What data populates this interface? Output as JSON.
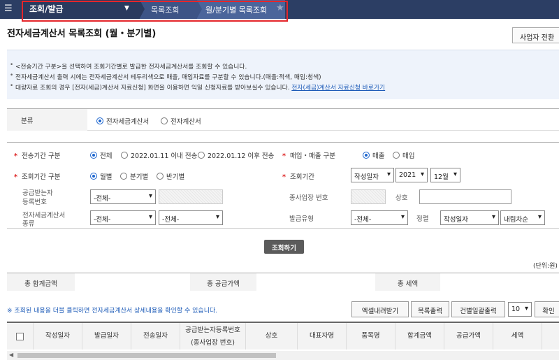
{
  "topbar": {
    "menu_icon": "hamburger-icon",
    "section_title": "조회/발급",
    "breadcrumb": [
      "목록조회",
      "월/분기별 목록조회"
    ],
    "favorite_icon": "star-icon"
  },
  "page": {
    "title": "전자세금계산서 목록조회 (월・분기별)",
    "biz_switch_label": "사업자 전환"
  },
  "notice": {
    "lines": [
      "<전송기간 구분>을 선택하여 조회기간별로 발급한 전자세금계산서를 조회할 수 있습니다.",
      "전자세금계산서 출력 시에는 전자세금계산서 테두리색으로 매출, 매입자료를 구분할 수 있습니다.(매출:적색, 매입:청색)",
      "대량자료 조회의 경우 [전자(세금)계산서 자료신청] 화면을 이용하면 익일 신청자료를 받아보실수 있습니다."
    ],
    "link_text": "전자(세금)계산서 자료신청 바로가기"
  },
  "classification": {
    "label": "분류",
    "options": [
      "전자세금계산서",
      "전자계산서"
    ],
    "selected": "전자세금계산서"
  },
  "search": {
    "transmit_period_label": "전송기간 구분",
    "transmit_options": [
      "전체",
      "2022.01.11 이내 전송",
      "2022.01.12 이후 전송"
    ],
    "sales_purchase_label": "매입・매출 구분",
    "sales_purchase_options": [
      "매출",
      "매입"
    ],
    "period_type_label": "조회기간 구분",
    "period_type_options": [
      "월별",
      "분기별",
      "반기별"
    ],
    "period_label": "조회기간",
    "period_basis": "작성일자",
    "year": "2021",
    "month": "12월",
    "receiver_reg_label_1": "공급받는자",
    "receiver_reg_label_2": "등록번호",
    "receiver_reg_select": "-전체-",
    "subbiz_label": "종사업장 번호",
    "company_label": "상호",
    "invoice_type_label_1": "전자세금계산서",
    "invoice_type_label_2": "종류",
    "invoice_type_select_1": "-전체-",
    "invoice_type_select_2": "-전체-",
    "issue_type_label": "발급유형",
    "issue_type_select": "-전체-",
    "sort_label": "정렬",
    "sort_by": "작성일자",
    "sort_order": "내림차순",
    "search_button": "조회하기"
  },
  "totals": {
    "unit": "(단위:원)",
    "total_label": "총 합계금액",
    "supply_label": "총 공급가액",
    "tax_label": "총 세액"
  },
  "list": {
    "hint": "※ 조회된 내용을 더블 클릭하면 전자세금계산서 상세내용을 확인할 수 있습니다.",
    "excel_button": "엑셀내려받기",
    "print_button": "목록출력",
    "bulk_print_button": "건별일괄출력",
    "page_size": "10",
    "confirm_button": "확인",
    "columns": [
      "작성일자",
      "발급일자",
      "전송일자",
      "공급받는자등록번호",
      "(종사업장 번호)",
      "상호",
      "대표자명",
      "품목명",
      "합계금액",
      "공급가액",
      "세액"
    ]
  }
}
